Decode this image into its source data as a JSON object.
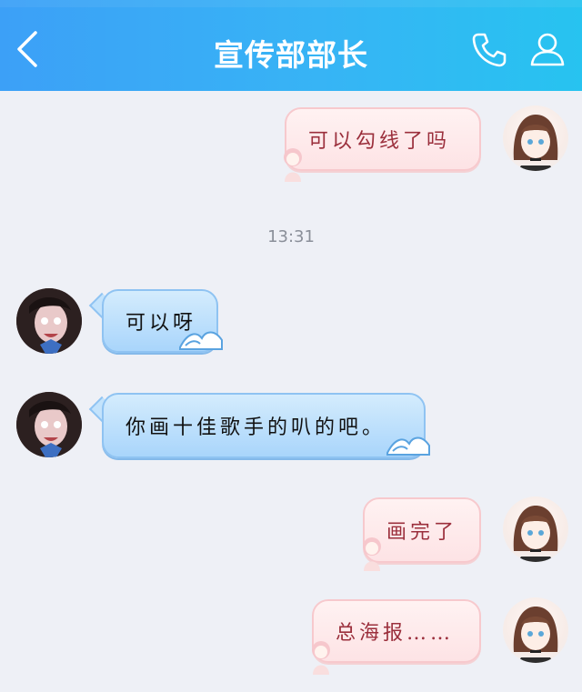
{
  "header": {
    "title": "宣传部部长"
  },
  "messages": [
    {
      "sender": "self",
      "text": "可以勾线了吗"
    },
    {
      "timestamp": "13:31"
    },
    {
      "sender": "other",
      "text": "可以呀"
    },
    {
      "sender": "other",
      "text": "你画十佳歌手的叭的吧。"
    },
    {
      "sender": "self",
      "text": "画完了"
    },
    {
      "sender": "self",
      "text": "总海报……"
    }
  ],
  "colors": {
    "header_gradient_start": "#3ca0f7",
    "header_gradient_end": "#27c3f0",
    "self_bubble_text": "#9b2f3c",
    "other_bubble": "#a9d5fb",
    "background": "#eef0f6"
  }
}
